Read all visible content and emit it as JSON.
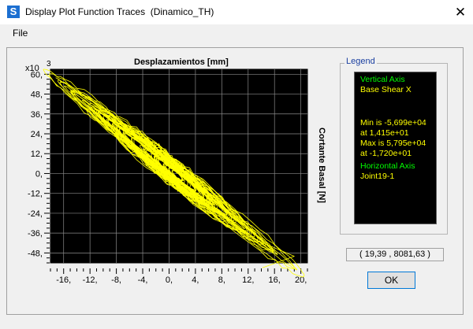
{
  "window": {
    "app_icon_letter": "S",
    "title": "Display Plot Function Traces  (Dinamico_TH)",
    "close_glyph": "✕"
  },
  "menu": {
    "file": "File"
  },
  "chart_data": {
    "type": "line",
    "title": "Desplazamientos [mm]",
    "ylabel": "Cortante Basal [N]",
    "y_multiplier_label": "x10",
    "y_multiplier_exponent": "3",
    "xlim": [
      -18,
      21
    ],
    "ylim": [
      -54,
      63
    ],
    "x_ticks": [
      -16,
      -12,
      -8,
      -4,
      0,
      4,
      8,
      12,
      16,
      20
    ],
    "x_tick_labels": [
      "-16,",
      "-12,",
      "-8,",
      "-4,",
      "0,",
      "4,",
      "8,",
      "12,",
      "16,",
      "20,"
    ],
    "y_ticks": [
      60,
      48,
      36,
      24,
      12,
      0,
      -12,
      -24,
      -36,
      -48
    ],
    "y_tick_labels": [
      "60,",
      "48,",
      "36,",
      "24,",
      "12,",
      "0,",
      "-12,",
      "-24,",
      "-36,",
      "-48,"
    ],
    "grid": true,
    "background": "#000000",
    "series_color": "#ffff00",
    "trend": {
      "x": [
        -17.2,
        19.0
      ],
      "y": [
        56.95,
        -56.99
      ]
    },
    "extremes": {
      "max": {
        "x": -17.2,
        "y": 57.95
      },
      "min": {
        "x": 14.15,
        "y": -56.99
      }
    }
  },
  "legend": {
    "label": "Legend",
    "vertical_axis_heading": "Vertical Axis",
    "vertical_axis_value": "Base Shear X",
    "min_line": "Min is -5,699e+04",
    "min_at": "at 1,415e+01",
    "max_line": "Max is 5,795e+04",
    "max_at": "at -1,720e+01",
    "horizontal_axis_heading": "Horizontal Axis",
    "horizontal_axis_value": "Joint19-1",
    "heading_color": "#00ff00",
    "value_color": "#ffff00"
  },
  "coordinate_readout": "( 19,39 , 8081,63 )",
  "ok_label": "OK"
}
